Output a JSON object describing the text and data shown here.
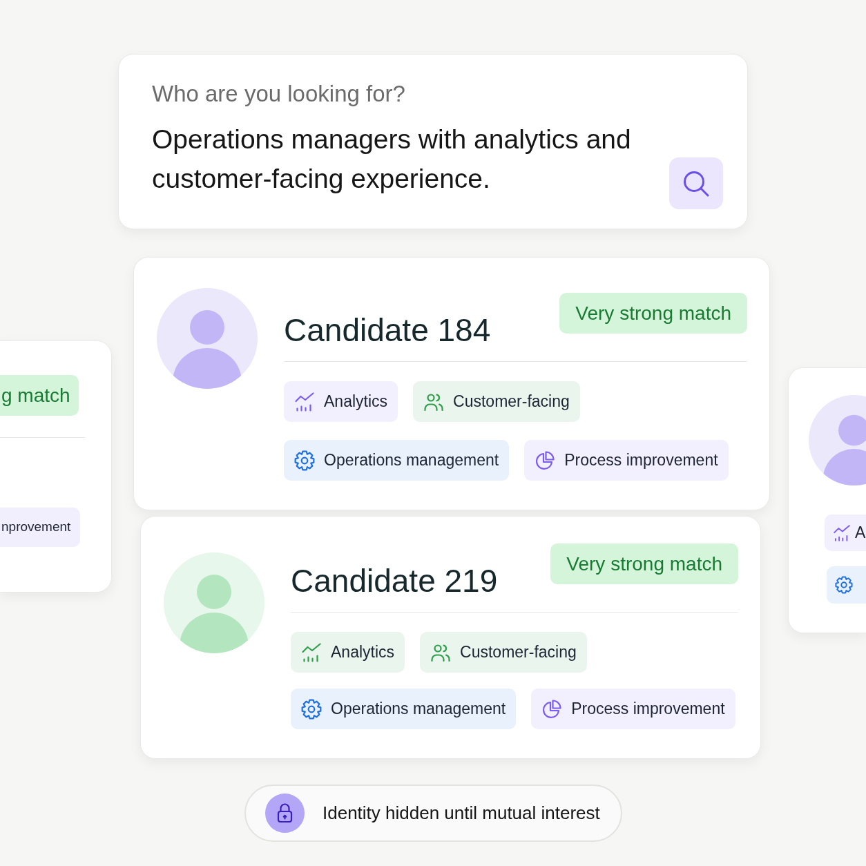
{
  "search": {
    "label": "Who are you looking for?",
    "query": "Operations managers with analytics and customer-facing experience."
  },
  "candidates": [
    {
      "name": "Candidate 184",
      "color": "#c3b6f7",
      "match": "Very strong match",
      "tags": [
        {
          "label": "Analytics",
          "kind": "chart",
          "color": "#7b5cf0"
        },
        {
          "label": "Customer-facing",
          "kind": "people",
          "color": "#2f9e4a"
        },
        {
          "label": "Operations management",
          "kind": "gear",
          "color": "#1f6fe0"
        },
        {
          "label": "Process improvement",
          "kind": "pie",
          "color": "#7b5cf0"
        }
      ]
    },
    {
      "name": "Candidate 219",
      "color": "#b3e6bf",
      "match": "Very strong match",
      "tags": [
        {
          "label": "Analytics",
          "kind": "chart",
          "color": "#2f9e4a"
        },
        {
          "label": "Customer-facing",
          "kind": "people",
          "color": "#2f9e4a"
        },
        {
          "label": "Operations management",
          "kind": "gear",
          "color": "#1f6fe0"
        },
        {
          "label": "Process improvement",
          "kind": "pie",
          "color": "#7b5cf0"
        }
      ]
    }
  ],
  "peek_left": {
    "match": "g match",
    "tags": [
      {
        "label": "nprovement"
      }
    ]
  },
  "peek_right": {
    "color": "#c3b6f7",
    "tags": [
      {
        "label": "A",
        "kind": "chart",
        "color": "#7b5cf0"
      },
      {
        "kind": "gear",
        "color": "#1f6fe0"
      }
    ]
  },
  "privacy_note": {
    "text": "Identity hidden until mutual interest"
  }
}
